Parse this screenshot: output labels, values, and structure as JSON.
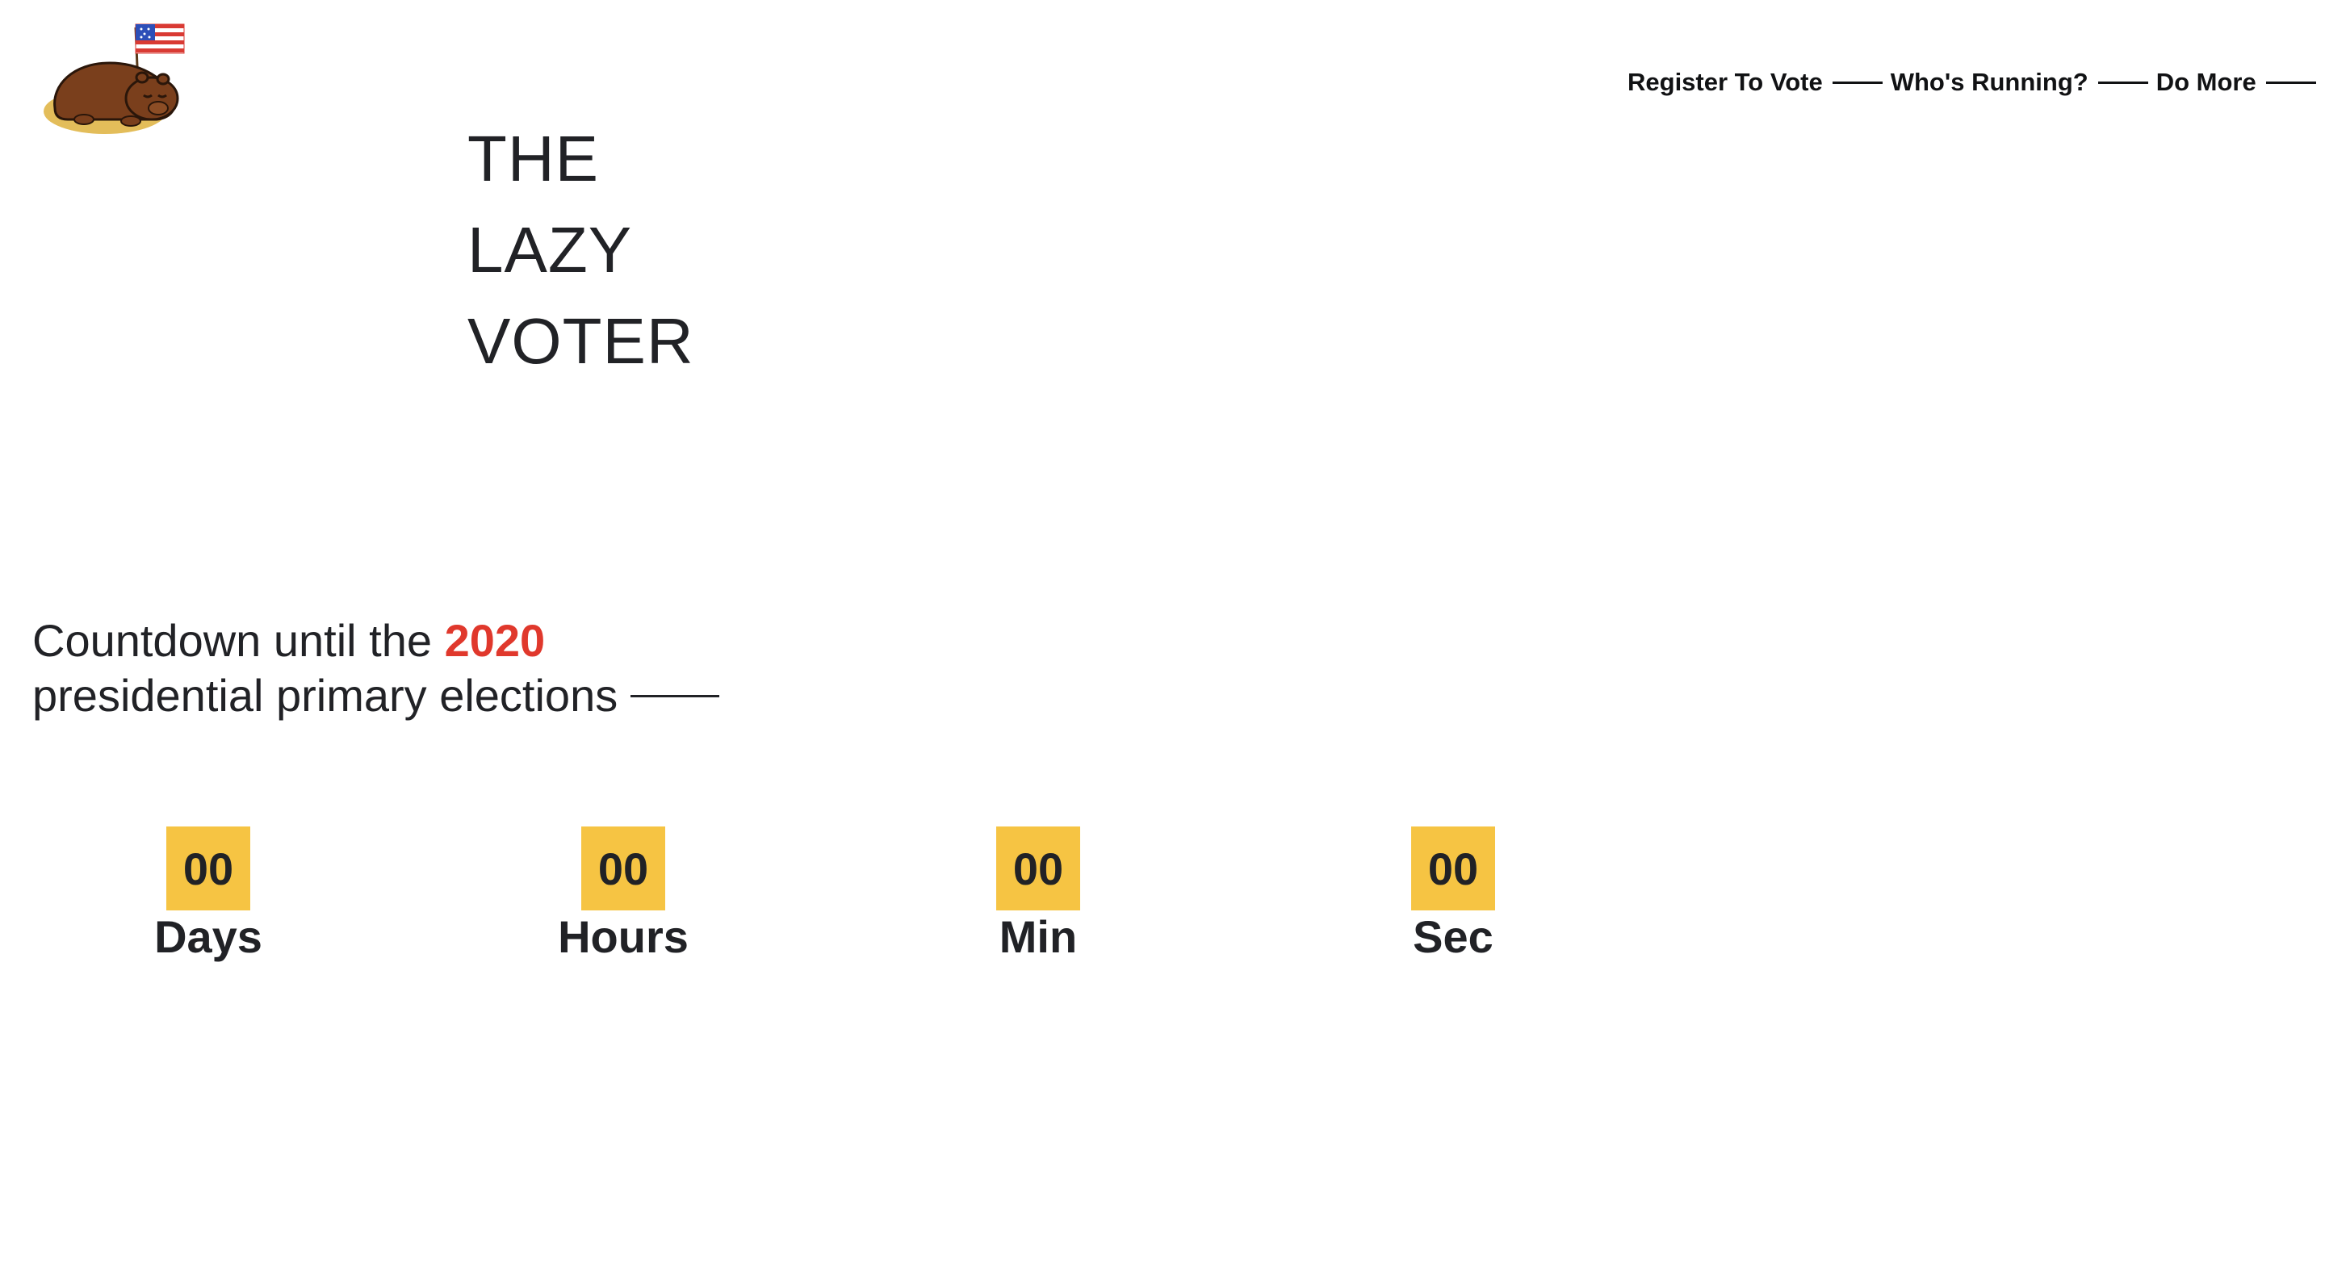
{
  "logo": {
    "alt_name": "lazy voter groundhog mascot with american flag"
  },
  "nav": {
    "items": [
      {
        "label": "Register To Vote"
      },
      {
        "label": "Who's Running?"
      },
      {
        "label": "Do More"
      }
    ]
  },
  "title": {
    "line1": "THE",
    "line2": "LAZY",
    "line3": "VOTER"
  },
  "countdown": {
    "heading_before": "Countdown until the ",
    "heading_year": "2020",
    "heading_after": "presidential primary elections",
    "units": [
      {
        "value": "00",
        "label": "Days"
      },
      {
        "value": "00",
        "label": "Hours"
      },
      {
        "value": "00",
        "label": "Min"
      },
      {
        "value": "00",
        "label": "Sec"
      }
    ]
  },
  "colors": {
    "accent_red": "#e0382c",
    "countdown_box": "#f6c443",
    "text": "#212226"
  }
}
